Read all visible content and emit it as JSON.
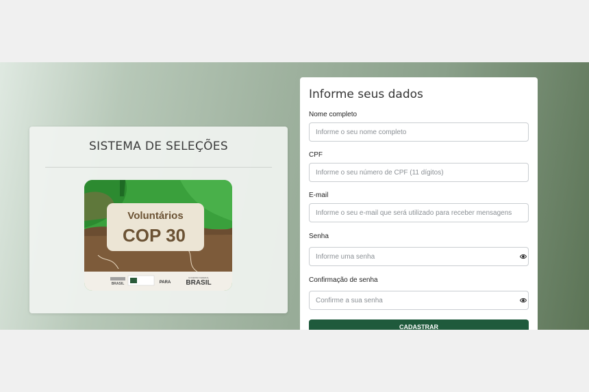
{
  "left_panel": {
    "title": "SISTEMA DE SELEÇÕES",
    "banner": {
      "line1": "Voluntários",
      "line2": "COP 30",
      "logos": [
        "BRASIL",
        "PARA",
        "BRASIL"
      ],
      "logo_note": "GOVERNO FEDERAL"
    }
  },
  "form": {
    "title": "Informe seus dados",
    "fields": [
      {
        "label": "Nome completo",
        "placeholder": "Informe o seu nome completo"
      },
      {
        "label": "CPF",
        "placeholder": "Informe o seu número de CPF (11 dígitos)"
      },
      {
        "label": "E-mail",
        "placeholder": "Informe o seu e-mail que será utilizado para receber mensagens."
      },
      {
        "label": "Senha",
        "placeholder": "Informe uma senha",
        "icon": "eye-icon"
      },
      {
        "label": "Confirmação de senha",
        "placeholder": "Confirme a sua senha",
        "icon": "eye-icon"
      }
    ],
    "submit_label": "CADASTRAR"
  },
  "colors": {
    "submit_button": "#1f5a3c",
    "banner_green": "#3aa03c",
    "banner_brown": "#7d5b3a"
  }
}
